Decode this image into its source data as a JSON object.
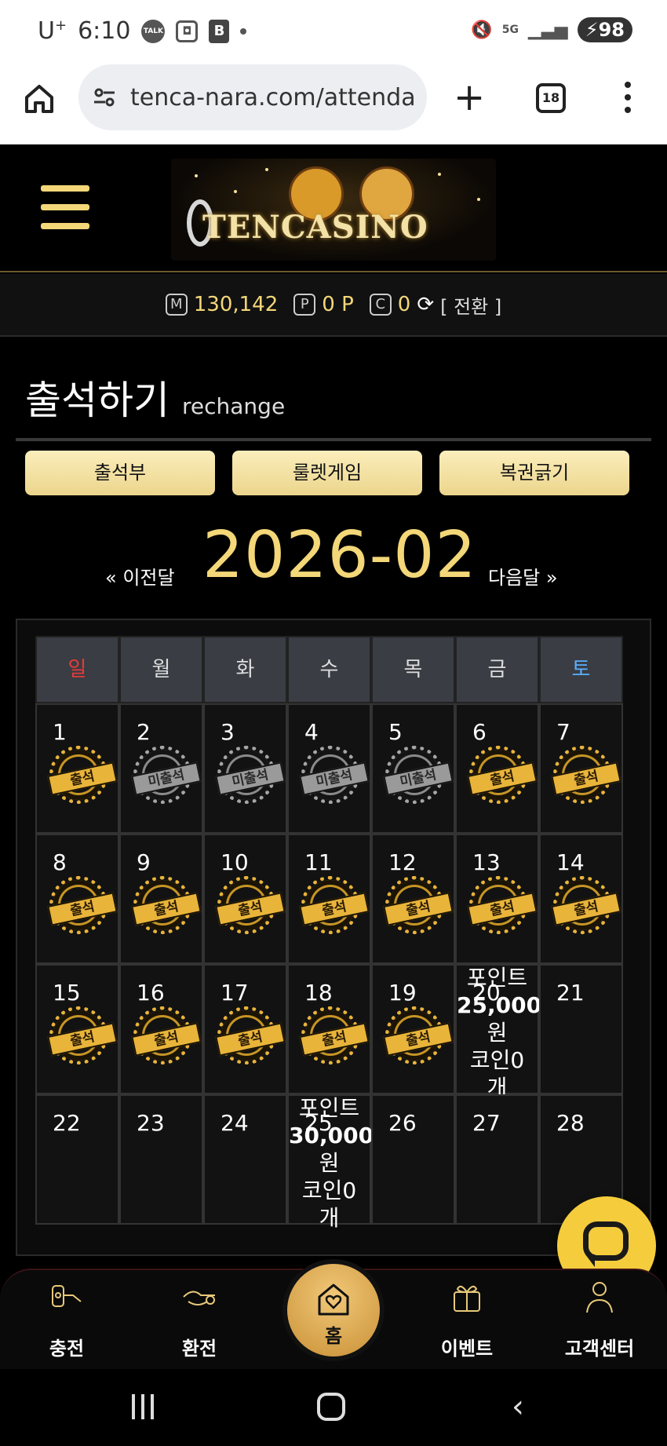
{
  "status_bar": {
    "carrier": "U",
    "carrier_sup": "+",
    "time": "6:10",
    "icons": [
      "talk-icon",
      "screenshot-icon",
      "b-app-icon",
      "dot-icon"
    ],
    "right_icons": [
      "mute-icon",
      "5g-icon",
      "signal-icon"
    ],
    "battery": "98"
  },
  "browser": {
    "url": "tenca-nara.com/attenda",
    "tab_count": "18"
  },
  "header": {
    "logo_text": "TENCASINO"
  },
  "balance": {
    "money_icon": "M",
    "money": "130,142",
    "point_icon": "P",
    "point": "0 P",
    "coin_icon": "C",
    "coin": "0",
    "convert_label": "[ 전환 ]"
  },
  "page": {
    "title": "출석하기",
    "subtitle": "rechange"
  },
  "buttons": {
    "attendance": "출석부",
    "roulette": "룰렛게임",
    "lottery": "복권긁기"
  },
  "month_nav": {
    "prev": "« 이전달",
    "current": "2026-02",
    "next": "다음달 »"
  },
  "calendar": {
    "weekdays": [
      "일",
      "월",
      "화",
      "수",
      "목",
      "금",
      "토"
    ],
    "stamp_attended": "출석",
    "stamp_missed": "미출석",
    "days": [
      {
        "d": "1",
        "s": "att"
      },
      {
        "d": "2",
        "s": "miss"
      },
      {
        "d": "3",
        "s": "miss"
      },
      {
        "d": "4",
        "s": "miss"
      },
      {
        "d": "5",
        "s": "miss"
      },
      {
        "d": "6",
        "s": "att"
      },
      {
        "d": "7",
        "s": "att"
      },
      {
        "d": "8",
        "s": "att"
      },
      {
        "d": "9",
        "s": "att"
      },
      {
        "d": "10",
        "s": "att"
      },
      {
        "d": "11",
        "s": "att"
      },
      {
        "d": "12",
        "s": "att"
      },
      {
        "d": "13",
        "s": "att"
      },
      {
        "d": "14",
        "s": "att"
      },
      {
        "d": "15",
        "s": "att"
      },
      {
        "d": "16",
        "s": "att"
      },
      {
        "d": "17",
        "s": "att"
      },
      {
        "d": "18",
        "s": "att"
      },
      {
        "d": "19",
        "s": "att"
      },
      {
        "d": "20",
        "s": "reward",
        "r1": "포인트",
        "r2": "25,000",
        "r3": "원",
        "r4": "코인0",
        "r5": "개"
      },
      {
        "d": "21",
        "s": ""
      },
      {
        "d": "22",
        "s": ""
      },
      {
        "d": "23",
        "s": ""
      },
      {
        "d": "24",
        "s": ""
      },
      {
        "d": "25",
        "s": "reward",
        "r1": "포인트",
        "r2": "30,000",
        "r3": "원",
        "r4": "코인0",
        "r5": "개"
      },
      {
        "d": "26",
        "s": ""
      },
      {
        "d": "27",
        "s": ""
      },
      {
        "d": "28",
        "s": ""
      }
    ]
  },
  "bottom_nav": {
    "charge": "충전",
    "exchange": "환전",
    "home": "홈",
    "event": "이벤트",
    "support": "고객센터"
  },
  "colors": {
    "gold": "#f3d778",
    "button_gold": "#ecd58c",
    "sunday": "#e83a3a",
    "saturday": "#5aaeff",
    "chat": "#f5cc3c"
  }
}
